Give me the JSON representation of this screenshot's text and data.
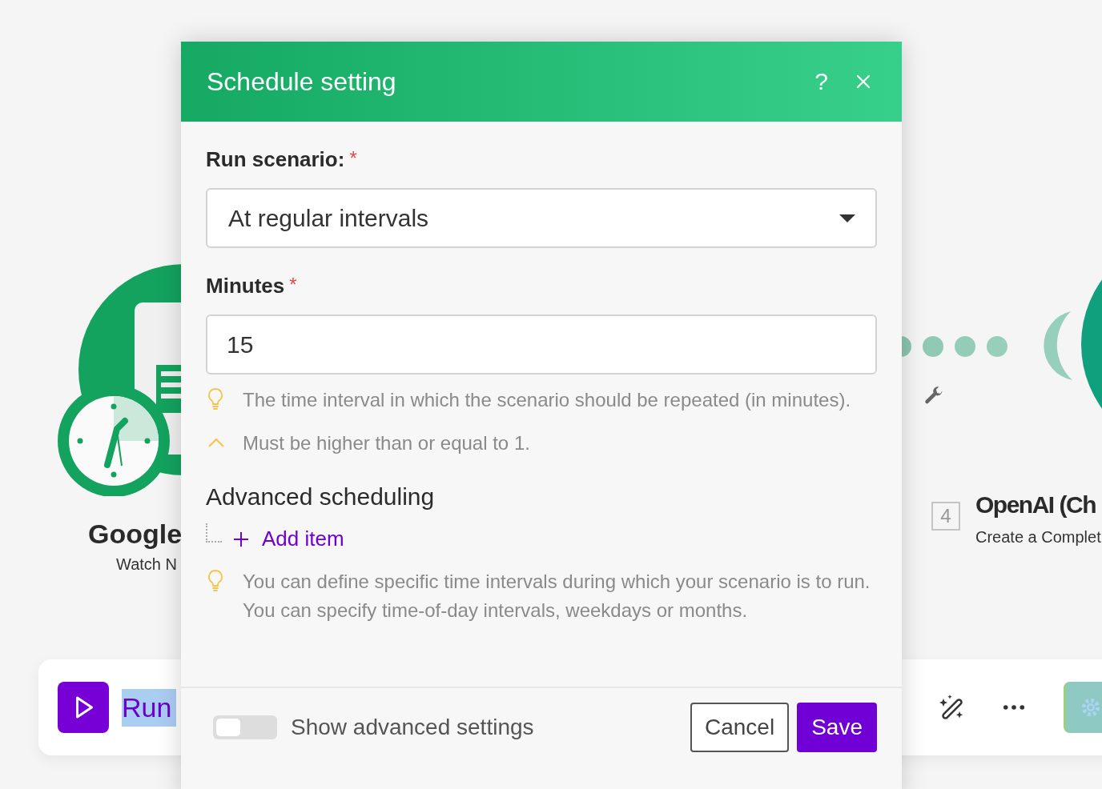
{
  "canvas": {
    "modules": [
      {
        "kind": "trigger",
        "title": "Google",
        "subtitle": "Watch N"
      },
      {
        "kind": "action",
        "number": "4",
        "title": "OpenAI (Ch",
        "subtitle": "Create a Complet"
      }
    ],
    "toolbar": {
      "run_label": "Run"
    }
  },
  "dialog": {
    "title": "Schedule setting",
    "help": "?",
    "fields": [
      {
        "kind": "select",
        "label": "Run scenario:",
        "required_mark": "*",
        "value": "At regular intervals"
      },
      {
        "kind": "number",
        "label": "Minutes",
        "required_mark": "*",
        "value": "15",
        "hints": [
          {
            "kind": "tip",
            "text": "The time interval in which the scenario should be repeated (in minutes)."
          },
          {
            "kind": "rule",
            "text": "Must be higher than or equal to 1."
          }
        ]
      }
    ],
    "advanced": {
      "title": "Advanced scheduling",
      "add_label": "Add item",
      "hint": "You can define specific time intervals during which your scenario is to run. You can specify time-of-day intervals, weekdays or months."
    },
    "toggle": {
      "label": "Show advanced settings",
      "on": false
    },
    "buttons": [
      {
        "kind": "secondary",
        "label": "Cancel"
      },
      {
        "kind": "primary",
        "label": "Save"
      }
    ]
  }
}
